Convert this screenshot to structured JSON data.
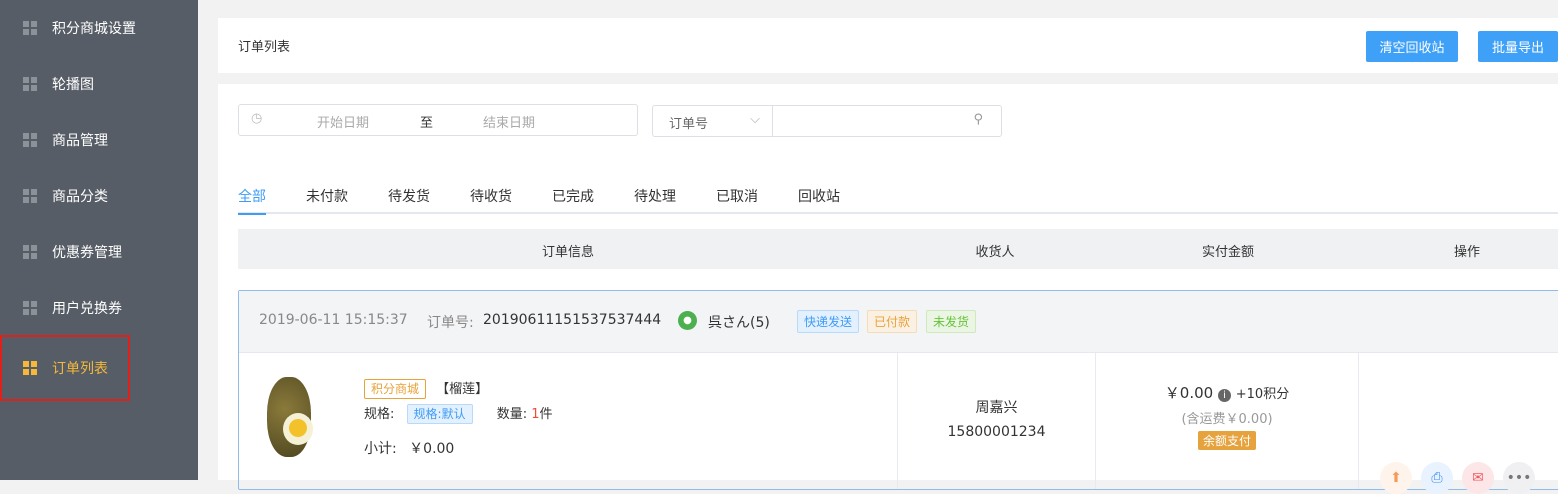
{
  "sidebar": {
    "items": [
      {
        "label": "积分商城设置"
      },
      {
        "label": "轮播图"
      },
      {
        "label": "商品管理"
      },
      {
        "label": "商品分类"
      },
      {
        "label": "优惠券管理"
      },
      {
        "label": "用户兑换券"
      },
      {
        "label": "订单列表"
      }
    ]
  },
  "header": {
    "title": "订单列表",
    "clear_label": "清空回收站",
    "export_label": "批量导出"
  },
  "filters": {
    "start_placeholder": "开始日期",
    "to": "至",
    "end_placeholder": "结束日期",
    "field_select": "订单号",
    "search_value": ""
  },
  "tabs": [
    "全部",
    "未付款",
    "待发货",
    "待收货",
    "已完成",
    "待处理",
    "已取消",
    "回收站"
  ],
  "table": {
    "headers": [
      "订单信息",
      "收货人",
      "实付金额",
      "操作"
    ]
  },
  "order": {
    "time": "2019-06-11 15:15:37",
    "no_label": "订单号:",
    "no": "20190611151537537444",
    "user": "呉さん(5)",
    "tags": [
      "快递发送",
      "已付款",
      "未发货"
    ],
    "product": {
      "source_tag": "积分商城",
      "name": "【榴莲】",
      "spec_label": "规格:",
      "spec": "规格:默认",
      "qty_label": "数量:",
      "qty": "1",
      "qty_unit": "件",
      "subtotal_label": "小计:",
      "subtotal": "￥0.00"
    },
    "receiver": {
      "name": "周嘉兴",
      "phone": "15800001234"
    },
    "amount": {
      "paid": "￥0.00",
      "points": "+10积分",
      "shipping": "(含运费￥0.00)",
      "method": "余额支付"
    }
  }
}
